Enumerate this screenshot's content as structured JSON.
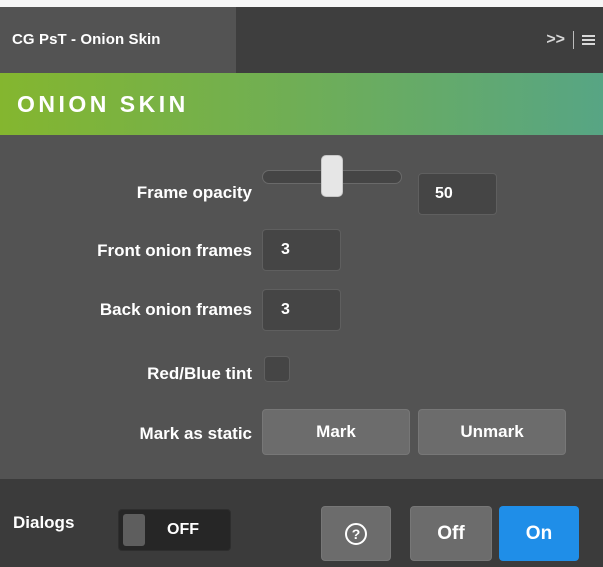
{
  "panel": {
    "tab_title": "CG PsT - Onion Skin",
    "expand_glyph": ">>",
    "header_title": "ONION SKIN"
  },
  "controls": {
    "frame_opacity": {
      "label": "Frame opacity",
      "value": "50",
      "slider_fraction": 0.5
    },
    "front_onion_frames": {
      "label": "Front onion frames",
      "value": "3"
    },
    "back_onion_frames": {
      "label": "Back onion frames",
      "value": "3"
    },
    "red_blue_tint": {
      "label": "Red/Blue tint",
      "checked": false
    },
    "mark_as_static": {
      "label": "Mark as static",
      "mark_label": "Mark",
      "unmark_label": "Unmark"
    }
  },
  "footer": {
    "dialogs_label": "Dialogs",
    "dialogs_toggle_text": "OFF",
    "help_glyph": "?",
    "off_label": "Off",
    "on_label": "On"
  },
  "colors": {
    "accent_blue": "#1f8ee8",
    "header_gradient_start": "#84b62f",
    "header_gradient_end": "#57a584"
  }
}
